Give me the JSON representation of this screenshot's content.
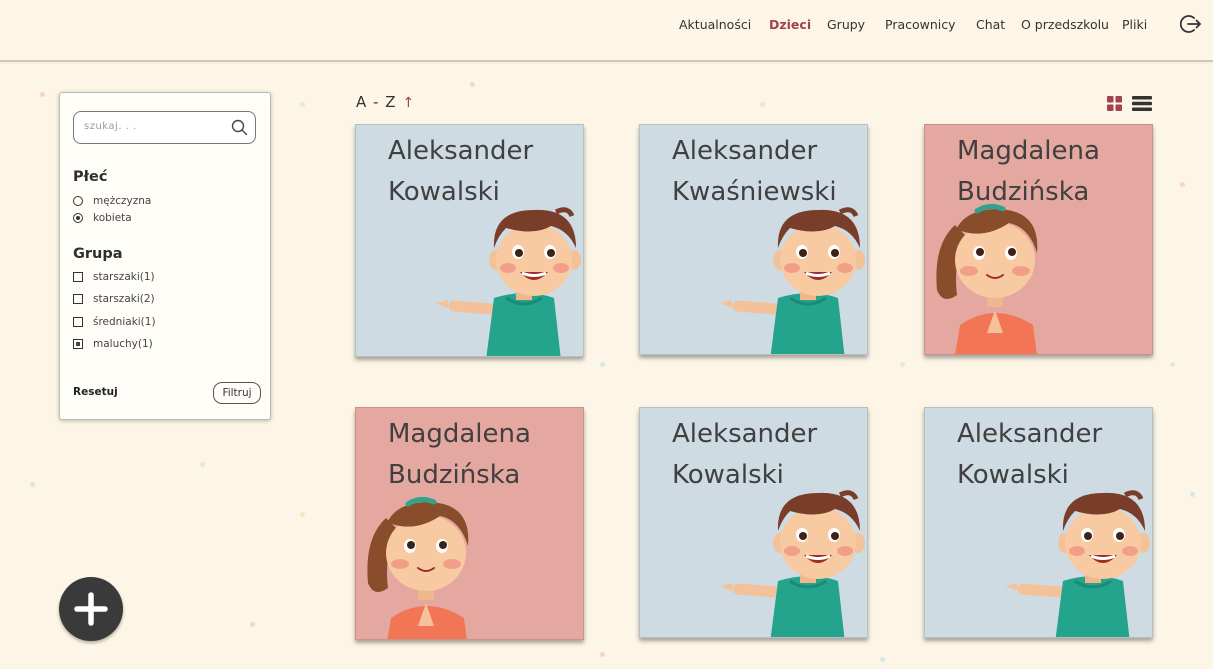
{
  "nav": {
    "items": [
      {
        "label": "Aktualności",
        "active": false
      },
      {
        "label": "Dzieci",
        "active": true
      },
      {
        "label": "Grupy",
        "active": false
      },
      {
        "label": "Pracownicy",
        "active": false
      },
      {
        "label": "Chat",
        "active": false
      },
      {
        "label": "O przedszkolu",
        "active": false
      },
      {
        "label": "Pliki",
        "active": false
      }
    ],
    "logout_icon": "logout-icon"
  },
  "filters": {
    "search_placeholder": "szukaj. . .",
    "gender": {
      "title": "Płeć",
      "options": [
        {
          "label": "mężczyzna",
          "selected": false
        },
        {
          "label": "kobieta",
          "selected": true
        }
      ]
    },
    "group": {
      "title": "Grupa",
      "options": [
        {
          "label": "starszaki(1)",
          "checked": false
        },
        {
          "label": "starszaki(2)",
          "checked": false
        },
        {
          "label": "średniaki(1)",
          "checked": false
        },
        {
          "label": "maluchy(1)",
          "checked": true
        }
      ]
    },
    "reset_label": "Resetuj",
    "filter_label": "Filtruj"
  },
  "sort": {
    "label": "A - Z",
    "arrow": "↑"
  },
  "view_icons": [
    "grid-view-icon",
    "list-view-icon"
  ],
  "children": [
    {
      "first": "Aleksander",
      "last": "Kowalski",
      "type": "boy"
    },
    {
      "first": "Aleksander",
      "last": "Kwaśniewski",
      "type": "boy"
    },
    {
      "first": "Magdalena",
      "last": "Budzińska",
      "type": "girl"
    },
    {
      "first": "Magdalena",
      "last": "Budzińska",
      "type": "girl"
    },
    {
      "first": "Aleksander",
      "last": "Kowalski",
      "type": "boy"
    },
    {
      "first": "Aleksander",
      "last": "Kowalski",
      "type": "boy"
    }
  ],
  "colors": {
    "background": "#fdf6e6",
    "accent": "#a3424f",
    "boy_card": "#cfdbe3",
    "girl_card": "#e5a8a0",
    "add_button": "#3b3a3b"
  }
}
